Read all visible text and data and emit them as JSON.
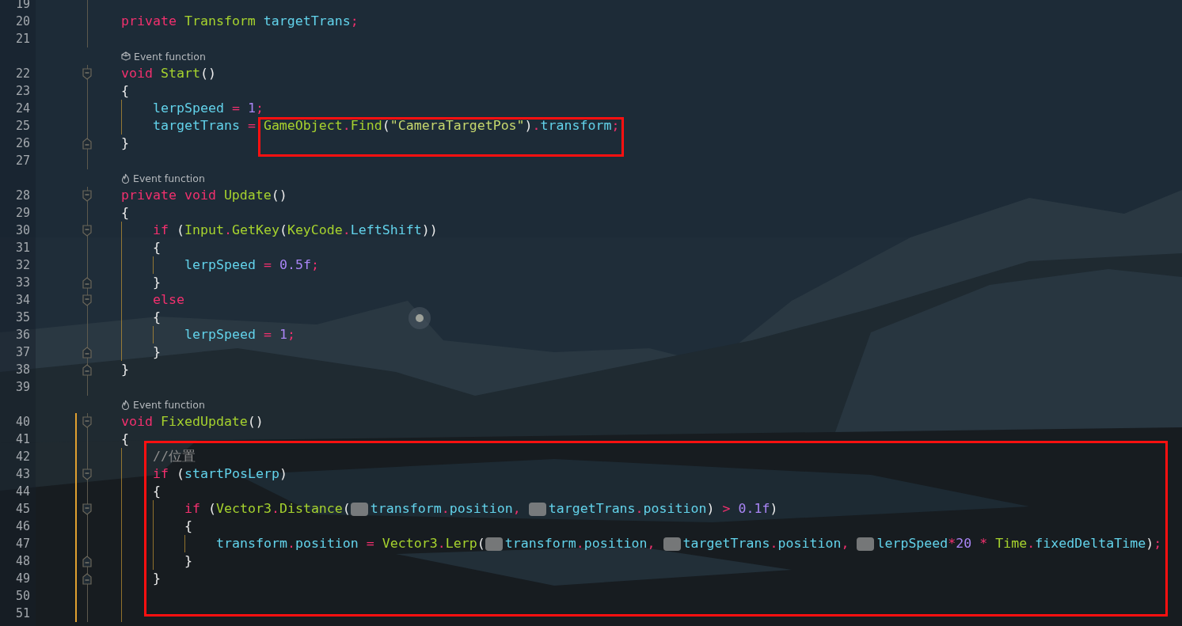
{
  "editor": {
    "lines": [
      {
        "kind": "line",
        "number": "19",
        "changed": false
      },
      {
        "kind": "line",
        "number": "20",
        "changed": false,
        "tokens": [
          {
            "kind": "kw",
            "text": "private "
          },
          {
            "kind": "type",
            "text": "Transform "
          },
          {
            "kind": "field",
            "text": "targetTrans"
          },
          {
            "kind": "op",
            "text": ";"
          }
        ]
      },
      {
        "kind": "line",
        "number": "21",
        "changed": false
      },
      {
        "kind": "lens",
        "text": "Event function"
      },
      {
        "kind": "fold-start",
        "number": "22",
        "changed": false,
        "tokens": [
          {
            "kind": "kw",
            "text": "void "
          },
          {
            "kind": "method",
            "text": "Start"
          },
          {
            "kind": "plain",
            "text": "()"
          }
        ]
      },
      {
        "kind": "line",
        "number": "23",
        "changed": false,
        "tokens": [
          {
            "kind": "plain",
            "text": "{"
          }
        ],
        "children": [
          {
            "kind": "line",
            "number": "24",
            "changed": false,
            "tokens": [
              {
                "kind": "field",
                "text": "lerpSpeed"
              },
              {
                "kind": "op",
                "text": " = "
              },
              {
                "kind": "num",
                "text": "1"
              },
              {
                "kind": "op",
                "text": ";"
              }
            ]
          },
          {
            "kind": "line",
            "number": "25",
            "changed": false,
            "tokens": [
              {
                "kind": "field",
                "text": "targetTrans"
              },
              {
                "kind": "op",
                "text": " = "
              },
              {
                "kind": "type",
                "text": "GameObject"
              },
              {
                "kind": "op",
                "text": "."
              },
              {
                "kind": "method",
                "text": "Find"
              },
              {
                "kind": "plain",
                "text": "("
              },
              {
                "kind": "str",
                "text": "\"CameraTargetPos\""
              },
              {
                "kind": "plain",
                "text": ")"
              },
              {
                "kind": "op",
                "text": "."
              },
              {
                "kind": "field",
                "text": "transform"
              },
              {
                "kind": "op",
                "text": ";"
              }
            ]
          }
        ]
      },
      {
        "kind": "fold-end",
        "number": "26",
        "changed": false,
        "tokens": [
          {
            "kind": "plain",
            "text": "}"
          }
        ]
      },
      {
        "kind": "line",
        "number": "27",
        "changed": false
      },
      {
        "kind": "lens",
        "text": "Event function"
      },
      {
        "kind": "fold-start",
        "number": "28",
        "changed": false,
        "tokens": [
          {
            "kind": "kw",
            "text": "private void "
          },
          {
            "kind": "method",
            "text": "Update"
          },
          {
            "kind": "plain",
            "text": "()"
          }
        ]
      },
      {
        "kind": "line",
        "number": "29",
        "changed": false,
        "tokens": [
          {
            "kind": "plain",
            "text": "{"
          }
        ],
        "children": [
          {
            "kind": "fold-start",
            "number": "30",
            "changed": false,
            "tokens": [
              {
                "kind": "kw",
                "text": "if "
              },
              {
                "kind": "plain",
                "text": "("
              },
              {
                "kind": "type",
                "text": "Input"
              },
              {
                "kind": "op",
                "text": "."
              },
              {
                "kind": "method",
                "text": "GetKey"
              },
              {
                "kind": "plain",
                "text": "("
              },
              {
                "kind": "type",
                "text": "KeyCode"
              },
              {
                "kind": "op",
                "text": "."
              },
              {
                "kind": "field",
                "text": "LeftShift"
              },
              {
                "kind": "plain",
                "text": "))"
              }
            ]
          },
          {
            "kind": "line",
            "number": "31",
            "changed": false,
            "tokens": [
              {
                "kind": "plain",
                "text": "{"
              }
            ],
            "children": [
              {
                "kind": "line",
                "number": "32",
                "changed": false,
                "tokens": [
                  {
                    "kind": "field",
                    "text": "lerpSpeed"
                  },
                  {
                    "kind": "op",
                    "text": " = "
                  },
                  {
                    "kind": "num",
                    "text": "0.5f"
                  },
                  {
                    "kind": "op",
                    "text": ";"
                  }
                ]
              }
            ]
          },
          {
            "kind": "fold-end",
            "number": "33",
            "changed": false,
            "tokens": [
              {
                "kind": "plain",
                "text": "}"
              }
            ]
          },
          {
            "kind": "fold-start",
            "number": "34",
            "changed": false,
            "tokens": [
              {
                "kind": "kw",
                "text": "else"
              }
            ]
          },
          {
            "kind": "line",
            "number": "35",
            "changed": false,
            "tokens": [
              {
                "kind": "plain",
                "text": "{"
              }
            ],
            "children": [
              {
                "kind": "line",
                "number": "36",
                "changed": false,
                "tokens": [
                  {
                    "kind": "field",
                    "text": "lerpSpeed"
                  },
                  {
                    "kind": "op",
                    "text": " = "
                  },
                  {
                    "kind": "num",
                    "text": "1"
                  },
                  {
                    "kind": "op",
                    "text": ";"
                  }
                ]
              }
            ]
          },
          {
            "kind": "fold-end",
            "number": "37",
            "changed": false,
            "tokens": [
              {
                "kind": "plain",
                "text": "}"
              }
            ]
          }
        ]
      },
      {
        "kind": "fold-end",
        "number": "38",
        "changed": false,
        "tokens": [
          {
            "kind": "plain",
            "text": "}"
          }
        ]
      },
      {
        "kind": "line",
        "number": "39",
        "changed": false
      },
      {
        "kind": "lens",
        "text": "Event function"
      },
      {
        "kind": "fold-start",
        "number": "40",
        "changed": true,
        "tokens": [
          {
            "kind": "kw",
            "text": "void "
          },
          {
            "kind": "method",
            "text": "FixedUpdate"
          },
          {
            "kind": "plain",
            "text": "()"
          }
        ]
      },
      {
        "kind": "line",
        "number": "41",
        "changed": true,
        "tokens": [
          {
            "kind": "plain",
            "text": "{"
          }
        ],
        "children": [
          {
            "kind": "line",
            "number": "42",
            "changed": true,
            "tokens": [
              {
                "kind": "comment",
                "text": "//位置"
              }
            ]
          },
          {
            "kind": "fold-start",
            "number": "43",
            "changed": true,
            "tokens": [
              {
                "kind": "kw",
                "text": "if "
              },
              {
                "kind": "plain",
                "text": "("
              },
              {
                "kind": "field",
                "text": "startPosLerp"
              },
              {
                "kind": "plain",
                "text": ")"
              }
            ]
          },
          {
            "kind": "line",
            "number": "44",
            "changed": true,
            "tokens": [
              {
                "kind": "plain",
                "text": "{"
              }
            ],
            "children": [
              {
                "kind": "fold-start",
                "number": "45",
                "changed": true,
                "tokens": [
                  {
                    "kind": "kw",
                    "text": "if "
                  },
                  {
                    "kind": "plain",
                    "text": "("
                  },
                  {
                    "kind": "type",
                    "text": "Vector3"
                  },
                  {
                    "kind": "op",
                    "text": "."
                  },
                  {
                    "kind": "method",
                    "text": "Distance"
                  },
                  {
                    "kind": "plain",
                    "text": "("
                  },
                  {
                    "kind": "hint"
                  },
                  {
                    "kind": "field",
                    "text": "transform"
                  },
                  {
                    "kind": "op",
                    "text": "."
                  },
                  {
                    "kind": "field",
                    "text": "position"
                  },
                  {
                    "kind": "op",
                    "text": ", "
                  },
                  {
                    "kind": "hint"
                  },
                  {
                    "kind": "field",
                    "text": "targetTrans"
                  },
                  {
                    "kind": "op",
                    "text": "."
                  },
                  {
                    "kind": "field",
                    "text": "position"
                  },
                  {
                    "kind": "plain",
                    "text": ") "
                  },
                  {
                    "kind": "op",
                    "text": "> "
                  },
                  {
                    "kind": "num",
                    "text": "0.1f"
                  },
                  {
                    "kind": "plain",
                    "text": ")"
                  }
                ]
              },
              {
                "kind": "line",
                "number": "46",
                "changed": true,
                "tokens": [
                  {
                    "kind": "plain",
                    "text": "{"
                  }
                ],
                "children": [
                  {
                    "kind": "line",
                    "number": "47",
                    "changed": true,
                    "tokens": [
                      {
                        "kind": "field",
                        "text": "transform"
                      },
                      {
                        "kind": "op",
                        "text": "."
                      },
                      {
                        "kind": "field",
                        "text": "position"
                      },
                      {
                        "kind": "op",
                        "text": " = "
                      },
                      {
                        "kind": "type",
                        "text": "Vector3"
                      },
                      {
                        "kind": "op",
                        "text": "."
                      },
                      {
                        "kind": "method",
                        "text": "Lerp"
                      },
                      {
                        "kind": "plain",
                        "text": "("
                      },
                      {
                        "kind": "hint"
                      },
                      {
                        "kind": "field",
                        "text": "transform"
                      },
                      {
                        "kind": "op",
                        "text": "."
                      },
                      {
                        "kind": "field",
                        "text": "position"
                      },
                      {
                        "kind": "op",
                        "text": ", "
                      },
                      {
                        "kind": "hint"
                      },
                      {
                        "kind": "field",
                        "text": "targetTrans"
                      },
                      {
                        "kind": "op",
                        "text": "."
                      },
                      {
                        "kind": "field",
                        "text": "position"
                      },
                      {
                        "kind": "op",
                        "text": ", "
                      },
                      {
                        "kind": "hint"
                      },
                      {
                        "kind": "field",
                        "text": "lerpSpeed"
                      },
                      {
                        "kind": "op",
                        "text": "*"
                      },
                      {
                        "kind": "num",
                        "text": "20"
                      },
                      {
                        "kind": "op",
                        "text": " * "
                      },
                      {
                        "kind": "type",
                        "text": "Time"
                      },
                      {
                        "kind": "op",
                        "text": "."
                      },
                      {
                        "kind": "field",
                        "text": "fixedDeltaTime"
                      },
                      {
                        "kind": "plain",
                        "text": ")"
                      },
                      {
                        "kind": "op",
                        "text": ";"
                      }
                    ]
                  }
                ]
              },
              {
                "kind": "fold-end",
                "number": "48",
                "changed": true,
                "tokens": [
                  {
                    "kind": "plain",
                    "text": "}"
                  }
                ]
              }
            ]
          },
          {
            "kind": "fold-end",
            "number": "49",
            "changed": true,
            "tokens": [
              {
                "kind": "plain",
                "text": "}"
              }
            ]
          },
          {
            "kind": "line",
            "number": "50",
            "changed": true
          },
          {
            "kind": "line",
            "number": "51",
            "changed": true
          }
        ]
      }
    ]
  }
}
